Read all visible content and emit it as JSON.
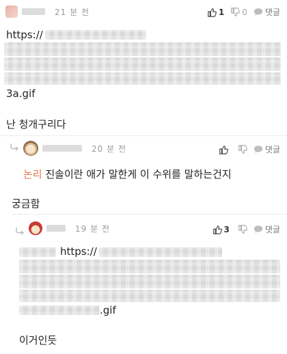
{
  "comments": [
    {
      "time": "21 분 전",
      "like_count": "1",
      "dislike_count": "0",
      "reply_label": "댓글",
      "link_prefix": "https://",
      "link_suffix": "3a.gif",
      "body": "난 청개구리다"
    },
    {
      "time": "20 분 전",
      "reply_label": "댓글",
      "mention": "논리",
      "body": " 진솔이란 애가 말한게 이 수위를 말하는건지",
      "body2": "궁금함"
    },
    {
      "time": "19 분 전",
      "like_count": "3",
      "reply_label": "댓글",
      "link_prefix": "https://",
      "link_suffix": ".gif",
      "body": "이거인듯"
    }
  ],
  "colors": {
    "background": "#ffffff",
    "mention": "#e8734a",
    "meta_gray": "#9a9a9a",
    "divider": "#ececec"
  },
  "icons": [
    "thumbs-up-icon",
    "thumbs-down-icon",
    "speech-bubble-icon",
    "reply-arrow-icon",
    "avatar"
  ]
}
